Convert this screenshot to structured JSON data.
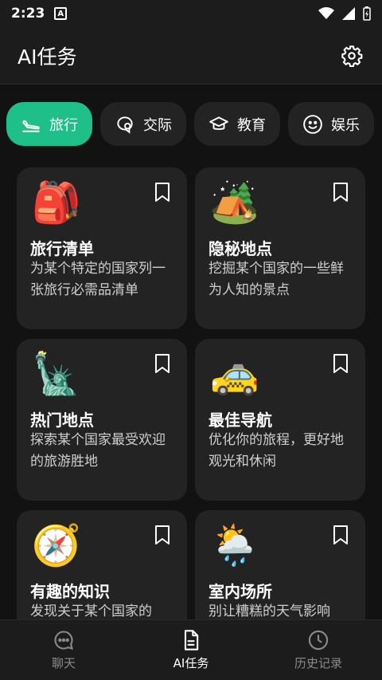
{
  "status_bar": {
    "time": "2:23",
    "notification": "A"
  },
  "app_bar": {
    "title": "AI任务"
  },
  "chips": [
    {
      "label": "旅行",
      "icon": "airplane-landing-icon",
      "active": true
    },
    {
      "label": "交际",
      "icon": "chat-bubble-icon",
      "active": false
    },
    {
      "label": "教育",
      "icon": "graduation-cap-icon",
      "active": false
    },
    {
      "label": "娱乐",
      "icon": "smiley-icon",
      "active": false
    }
  ],
  "cards": [
    {
      "emoji": "🎒",
      "icon": "backpack-icon",
      "title": "旅行清单",
      "desc": "为某个特定的国家列一张旅行必需品清单"
    },
    {
      "emoji": "🏕️",
      "icon": "camping-icon",
      "title": "隐秘地点",
      "desc": "挖掘某个国家的一些鲜为人知的景点"
    },
    {
      "emoji": "🗽",
      "icon": "statue-of-liberty-icon",
      "title": "热门地点",
      "desc": "探索某个国家最受欢迎的旅游胜地"
    },
    {
      "emoji": "🚕",
      "icon": "taxi-icon",
      "title": "最佳导航",
      "desc": "优化你的旅程，更好地观光和休闲"
    },
    {
      "emoji": "🧭",
      "icon": "compass-icon",
      "title": "有趣的知识",
      "desc": "发现关于某个国家的"
    },
    {
      "emoji": "🌦️",
      "icon": "rain-cloud-icon",
      "title": "室内场所",
      "desc": "别让糟糕的天气影响"
    }
  ],
  "bottom_nav": [
    {
      "label": "聊天",
      "icon": "chat-icon",
      "active": false
    },
    {
      "label": "AI任务",
      "icon": "task-document-icon",
      "active": true
    },
    {
      "label": "历史记录",
      "icon": "clock-icon",
      "active": false
    }
  ],
  "colors": {
    "accent": "#1fbf8a",
    "background": "#121212",
    "card": "#232323",
    "bar": "#1c1c1c"
  }
}
